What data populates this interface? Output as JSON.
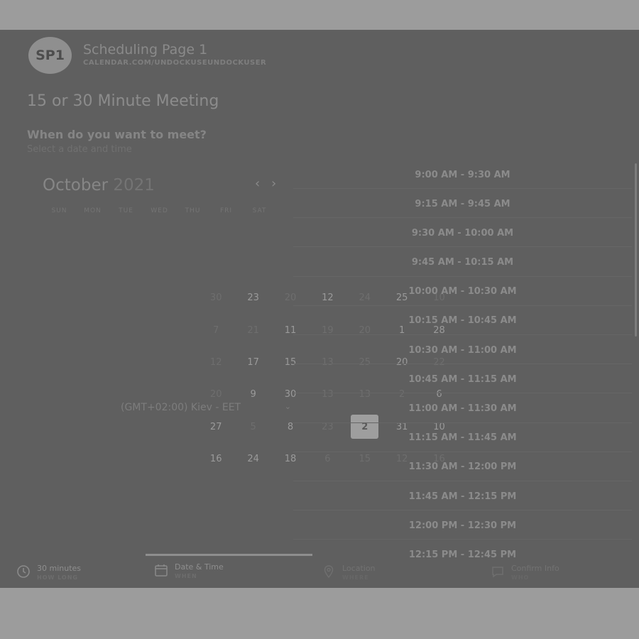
{
  "header": {
    "avatar_initials": "SP1",
    "page_name": "Scheduling Page 1",
    "page_url": "CALENDAR.COM/UNDOCKUSEUNDOCKUSER"
  },
  "meeting_title": "15 or 30 Minute Meeting",
  "when": {
    "heading": "When do you want to meet?",
    "subheading": "Select a date and time"
  },
  "calendar": {
    "month": "October",
    "year": "2021",
    "prev_icon": "chevron-left-icon",
    "next_icon": "chevron-right-icon",
    "weekdays": [
      "SUN",
      "MON",
      "TUE",
      "WED",
      "THU",
      "FRI",
      "SAT"
    ],
    "dates": [
      [
        "30",
        "23",
        "20",
        "12",
        "24",
        "25",
        "10"
      ],
      [
        "7",
        "21",
        "11",
        "19",
        "20",
        "1",
        "28"
      ],
      [
        "12",
        "17",
        "15",
        "13",
        "25",
        "20",
        "22"
      ],
      [
        "20",
        "9",
        "30",
        "13",
        "13",
        "2",
        "6"
      ],
      [
        "27",
        "5",
        "8",
        "23",
        "2",
        "31",
        "10"
      ],
      [
        "16",
        "24",
        "18",
        "6",
        "15",
        "12",
        "16"
      ]
    ],
    "selected_date": "2"
  },
  "timezone": {
    "label": "(GMT+02:00) Kiev - EET",
    "chevron_icon": "chevron-down-icon"
  },
  "time_slots": [
    "9:00 AM - 9:30 AM",
    "9:15 AM - 9:45 AM",
    "9:30 AM - 10:00 AM",
    "9:45 AM - 10:15 AM",
    "10:00 AM - 10:30 AM",
    "10:15 AM - 10:45 AM",
    "10:30 AM - 11:00 AM",
    "10:45 AM - 11:15 AM",
    "11:00 AM - 11:30 AM",
    "11:15 AM - 11:45 AM",
    "11:30 AM - 12:00 PM",
    "11:45 AM - 12:15 PM",
    "12:00 PM - 12:30 PM",
    "12:15 PM - 12:45 PM"
  ],
  "steps": [
    {
      "icon": "clock-icon",
      "title": "30 minutes",
      "subtitle": "HOW LONG"
    },
    {
      "icon": "calendar-icon",
      "title": "Date & Time",
      "subtitle": "WHEN"
    },
    {
      "icon": "location-pin-icon",
      "title": "Location",
      "subtitle": "WHERE"
    },
    {
      "icon": "message-icon",
      "title": "Confirm Info",
      "subtitle": "WHO"
    }
  ],
  "colors": {
    "overlay_dark": "#5f5f5f",
    "page_frame": "#9c9c9c",
    "selected_date_bg": "#9e9e9e"
  }
}
